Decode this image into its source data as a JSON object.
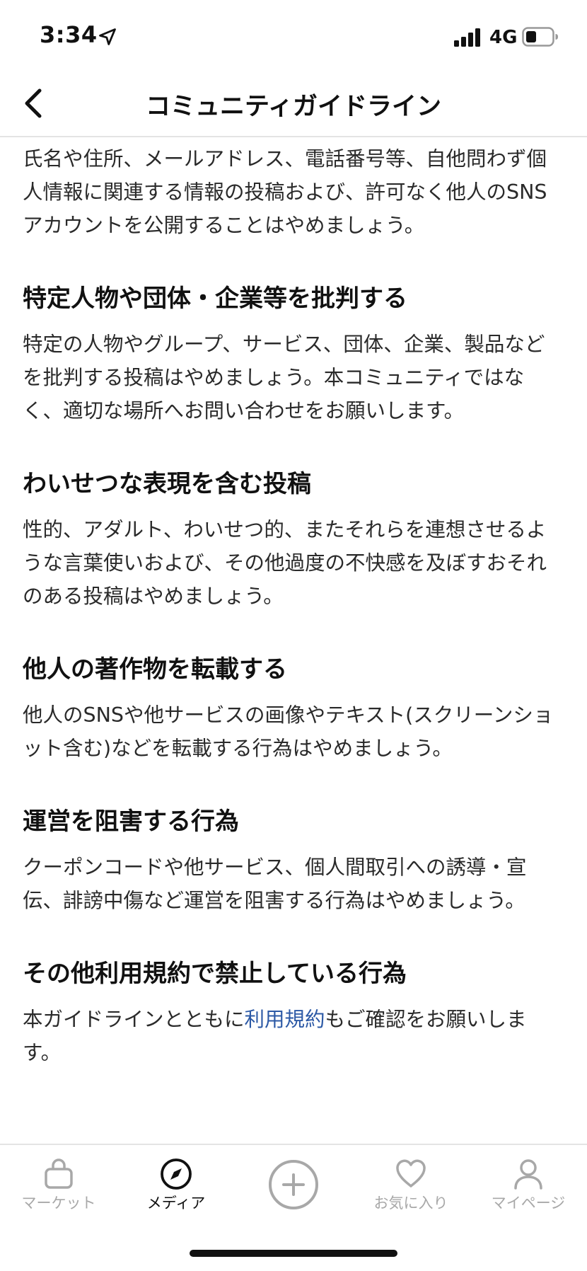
{
  "status_bar": {
    "time": "3:34",
    "network": "4G"
  },
  "header": {
    "title": "コミュニティガイドライン"
  },
  "content": {
    "intro": "氏名や住所、メールアドレス、電話番号等、自他問わず個人情報に関連する情報の投稿および、許可なく他人のSNSアカウントを公開することはやめましょう。",
    "sections": [
      {
        "heading": "特定人物や団体・企業等を批判する",
        "body": "特定の人物やグループ、サービス、団体、企業、製品などを批判する投稿はやめましょう。本コミュニティではなく、適切な場所へお問い合わせをお願いします。"
      },
      {
        "heading": "わいせつな表現を含む投稿",
        "body": "性的、アダルト、わいせつ的、またそれらを連想させるような言葉使いおよび、その他過度の不快感を及ぼすおそれのある投稿はやめましょう。"
      },
      {
        "heading": "他人の著作物を転載する",
        "body": "他人のSNSや他サービスの画像やテキスト(スクリーンショット含む)などを転載する行為はやめましょう。"
      },
      {
        "heading": "運営を阻害する行為",
        "body": "クーポンコードや他サービス、個人間取引への誘導・宣伝、誹謗中傷など運営を阻害する行為はやめましょう。"
      },
      {
        "heading": "その他利用規約で禁止している行為",
        "body_before": "本ガイドラインとともに",
        "link": "利用規約",
        "body_after": "もご確認をお願いします。"
      }
    ]
  },
  "tab_bar": {
    "tabs": [
      {
        "label": "マーケット",
        "icon": "shopping-bag-icon",
        "active": false
      },
      {
        "label": "メディア",
        "icon": "compass-icon",
        "active": true
      },
      {
        "label": "",
        "icon": "plus-circle-icon",
        "active": false
      },
      {
        "label": "お気に入り",
        "icon": "heart-icon",
        "active": false
      },
      {
        "label": "マイページ",
        "icon": "person-icon",
        "active": false
      }
    ]
  },
  "colors": {
    "link": "#2d5aa6",
    "inactive_tab": "#a8a8a8",
    "text": "#1a1a1a"
  }
}
